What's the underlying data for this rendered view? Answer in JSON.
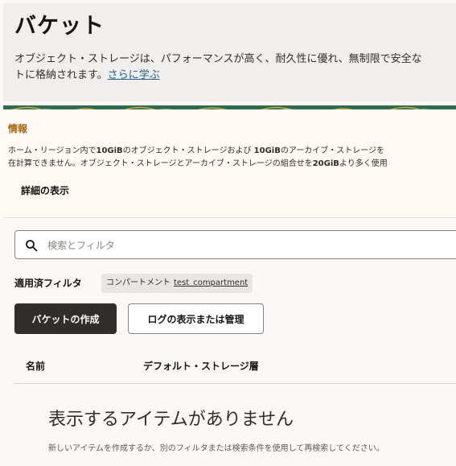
{
  "header": {
    "title": "バケット",
    "description_line1": "オブジェクト・ストレージは、パフォーマンスが高く、耐久性に優れ、無制限で安全な",
    "description_line2": "トに格納されます。",
    "learn_more_link": "さらに学ぶ"
  },
  "info": {
    "title": "情報",
    "line1": {
      "pre": "ホーム・リージョン内で",
      "b1": "10GiB",
      "mid": "のオブジェクト・ストレージおよび ",
      "b2": "10GiB",
      "post": "のアーカイブ・ストレージを"
    },
    "line2": {
      "pre": "在計算できません。オブジェクト・ストレージとアーカイブ・ストレージの組合せを",
      "b": "20GiB",
      "post": "より多く使用"
    },
    "details_button": "詳細の表示"
  },
  "search": {
    "placeholder": "検索とフィルタ"
  },
  "filters": {
    "label": "適用済フィルタ",
    "chip_key": "コンパートメント",
    "chip_value": "test_compartment"
  },
  "toolbar": {
    "create_button": "バケットの作成",
    "logs_button": "ログの表示または管理"
  },
  "table": {
    "columns": [
      "名前",
      "デフォルト・ストレージ層"
    ]
  },
  "empty_state": {
    "title": "表示するアイテムがありません",
    "description": "新しいアイテムを作成するか、別のフィルタまたは検索条件を使用して再検索してください。"
  },
  "colors": {
    "primary_button": "#312d2a",
    "info_background": "#fef9f2",
    "info_title": "#ac630c",
    "link": "#1f5f8b",
    "banner_green": "#2f6b4c",
    "banner_gold": "#c9a94a"
  }
}
